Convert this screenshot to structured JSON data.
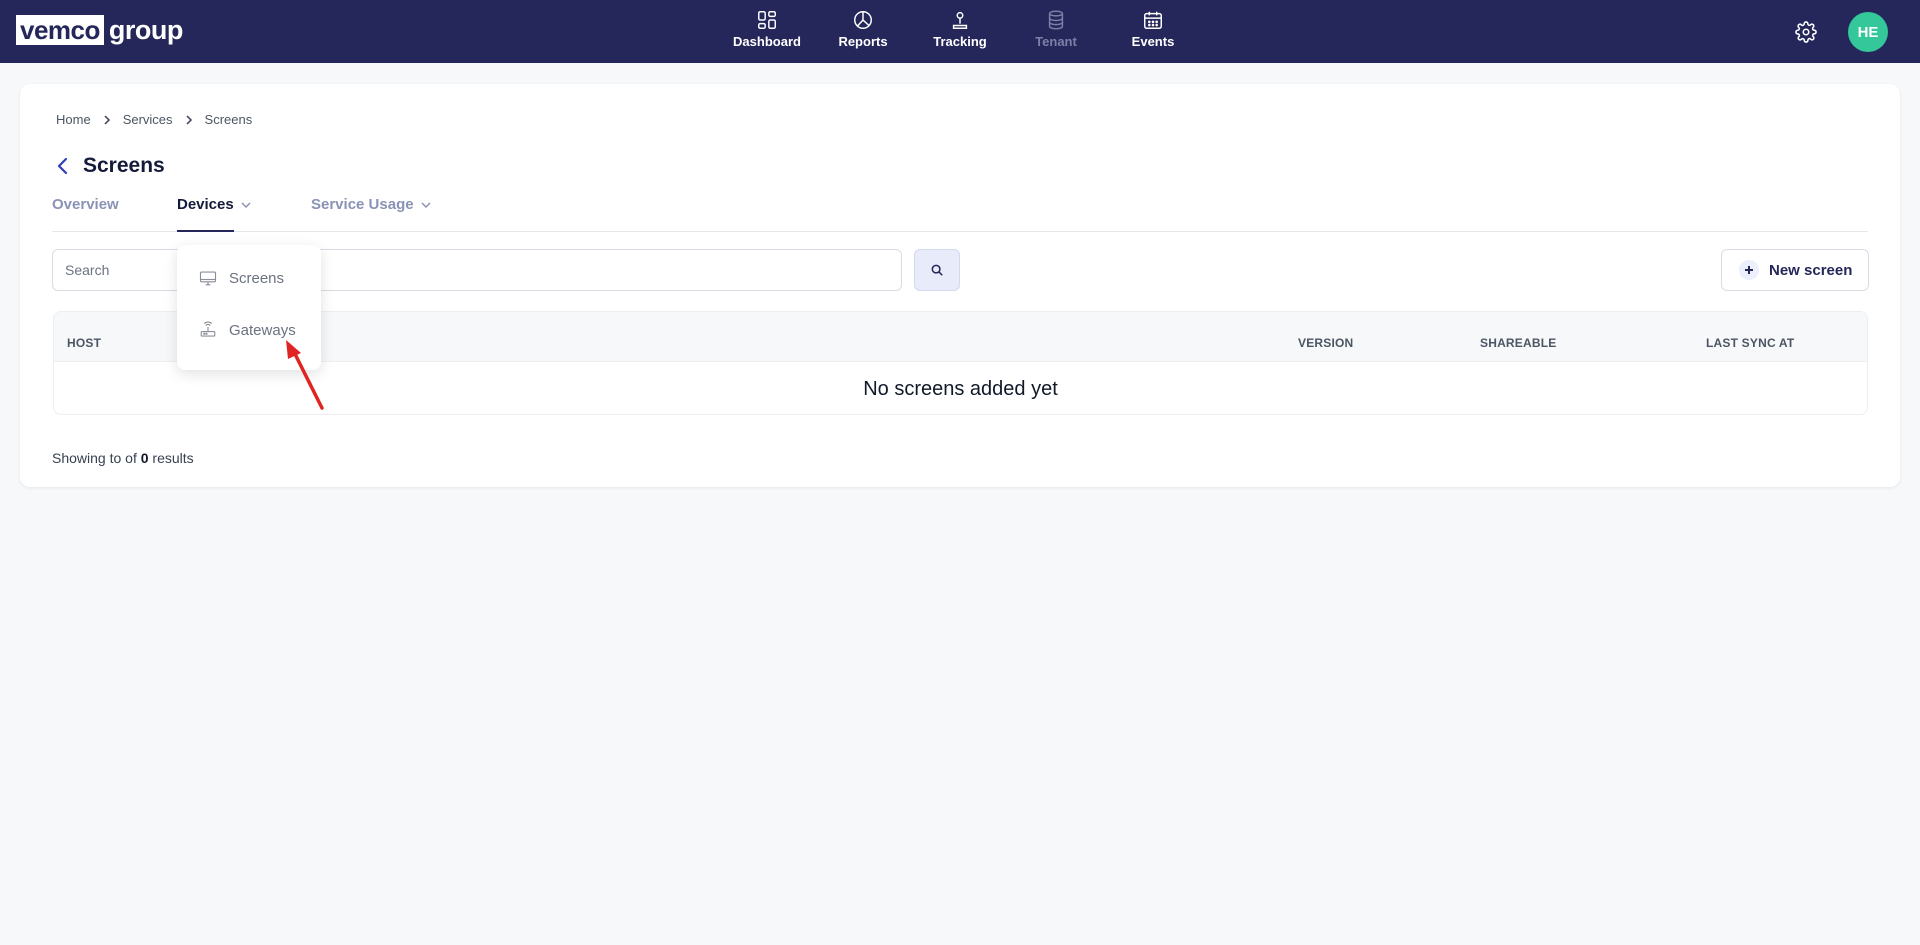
{
  "brand": {
    "logo_box": "vemco",
    "logo_text": "group"
  },
  "nav": {
    "items": [
      {
        "label": "Dashboard",
        "icon": "dashboard-icon"
      },
      {
        "label": "Reports",
        "icon": "pie-chart-icon"
      },
      {
        "label": "Tracking",
        "icon": "location-pin-icon"
      },
      {
        "label": "Tenant",
        "icon": "database-icon",
        "disabled": true
      },
      {
        "label": "Events",
        "icon": "calendar-icon"
      }
    ]
  },
  "header": {
    "avatar_initials": "HE",
    "avatar_color": "#34c79a",
    "settings_icon": "gear-icon"
  },
  "breadcrumb": [
    "Home",
    "Services",
    "Screens"
  ],
  "page": {
    "title": "Screens"
  },
  "tabs": [
    {
      "label": "Overview"
    },
    {
      "label": "Devices",
      "active": true
    },
    {
      "label": "Service Usage"
    }
  ],
  "search": {
    "placeholder": "Search"
  },
  "toolbar": {
    "new_label": "New screen"
  },
  "table": {
    "columns": [
      "HOST",
      "VERSION",
      "SHAREABLE",
      "LAST SYNC AT"
    ],
    "empty_message": "No screens added yet"
  },
  "pagination": {
    "prefix": "Showing to of",
    "count": "0",
    "suffix": "results"
  },
  "devices_menu": {
    "items": [
      {
        "label": "Screens",
        "icon": "monitor-icon"
      },
      {
        "label": "Gateways",
        "icon": "gateway-icon"
      }
    ]
  },
  "colors": {
    "nav_bg": "#25275a",
    "accent": "#25275a",
    "annotation_arrow": "#e02424"
  }
}
